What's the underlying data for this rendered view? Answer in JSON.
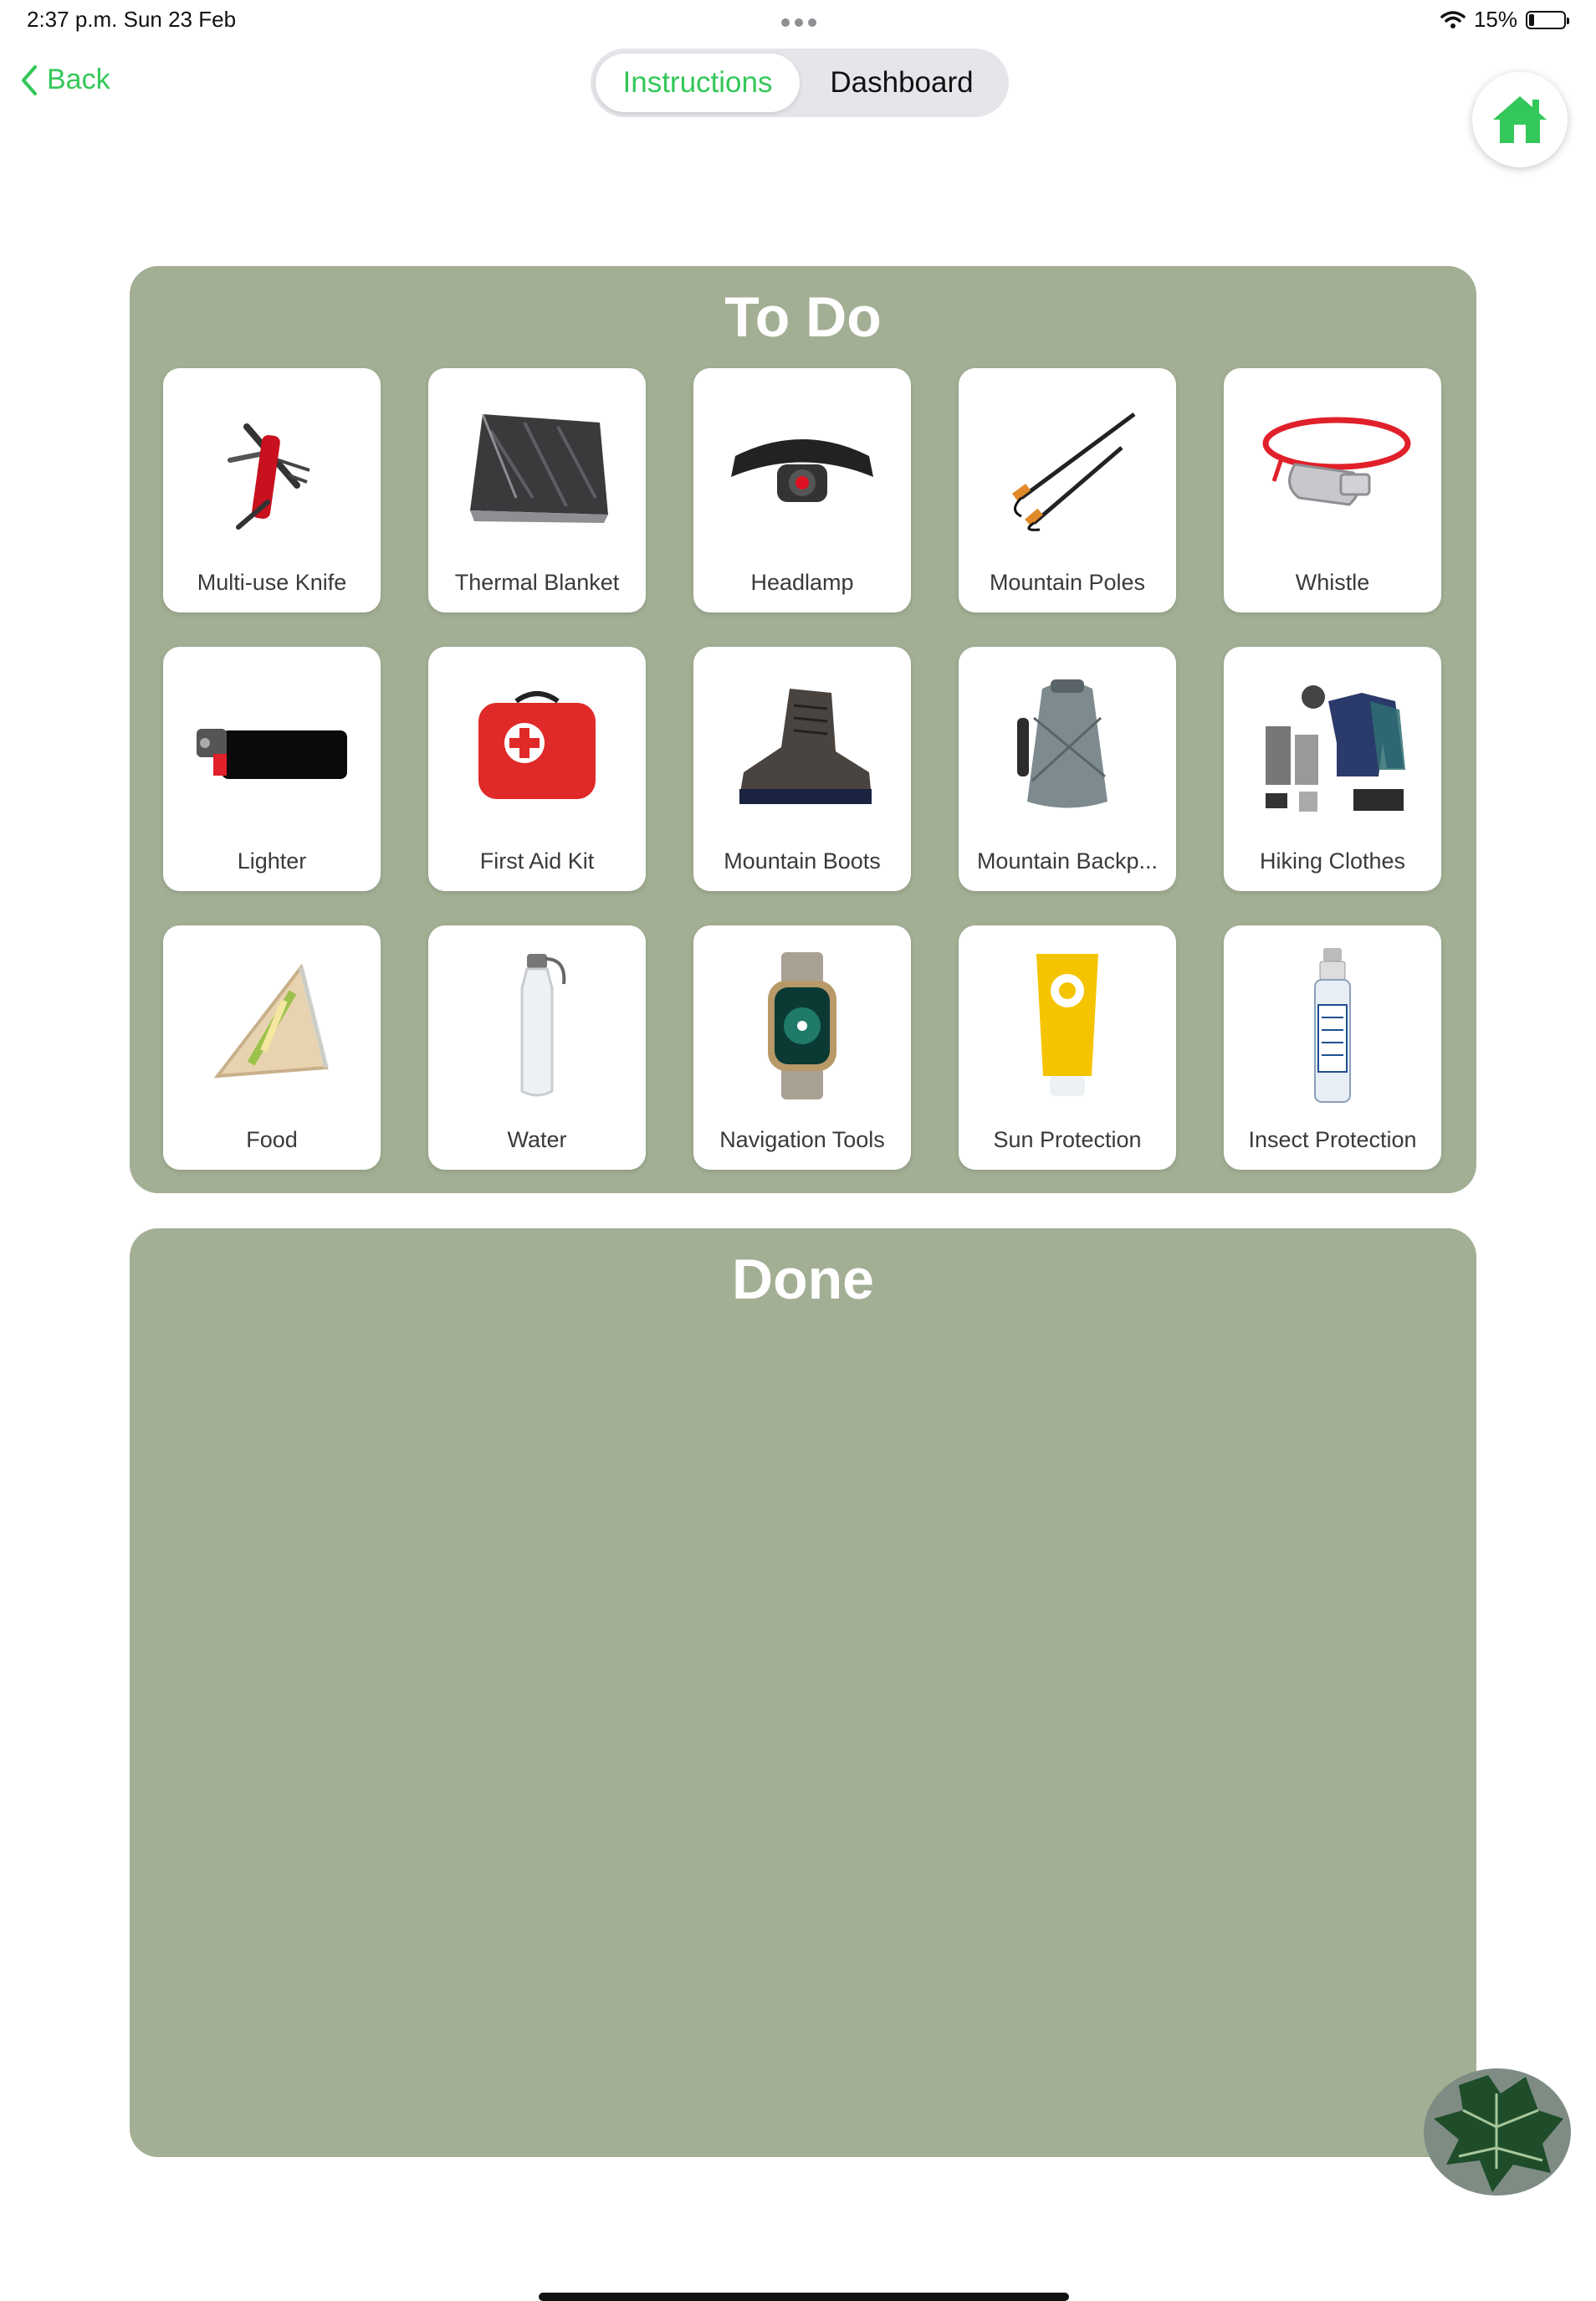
{
  "status": {
    "time": "2:37 p.m.   Sun 23 Feb",
    "battery": "15%",
    "battery_level": 0.15
  },
  "nav": {
    "back_label": "Back",
    "tabs": [
      "Instructions",
      "Dashboard"
    ],
    "selected_tab": "Instructions"
  },
  "todo": {
    "title": "To Do",
    "items": [
      {
        "label": "Multi-use Knife",
        "icon": "knife-icon"
      },
      {
        "label": "Thermal Blanket",
        "icon": "blanket-icon"
      },
      {
        "label": "Headlamp",
        "icon": "headlamp-icon"
      },
      {
        "label": "Mountain Poles",
        "icon": "poles-icon"
      },
      {
        "label": "Whistle",
        "icon": "whistle-icon"
      },
      {
        "label": "Lighter",
        "icon": "lighter-icon"
      },
      {
        "label": "First Aid Kit",
        "icon": "first-aid-icon"
      },
      {
        "label": "Mountain Boots",
        "icon": "boot-icon"
      },
      {
        "label": "Mountain Backp...",
        "icon": "backpack-icon"
      },
      {
        "label": "Hiking Clothes",
        "icon": "clothes-icon"
      },
      {
        "label": "Food",
        "icon": "sandwich-icon"
      },
      {
        "label": "Water",
        "icon": "bottle-icon"
      },
      {
        "label": "Navigation Tools",
        "icon": "watch-icon"
      },
      {
        "label": "Sun Protection",
        "icon": "sunscreen-icon"
      },
      {
        "label": "Insect Protection",
        "icon": "spray-icon"
      }
    ]
  },
  "done": {
    "title": "Done",
    "items": []
  },
  "colors": {
    "accent": "#34c759",
    "panel": "#a2af94"
  }
}
